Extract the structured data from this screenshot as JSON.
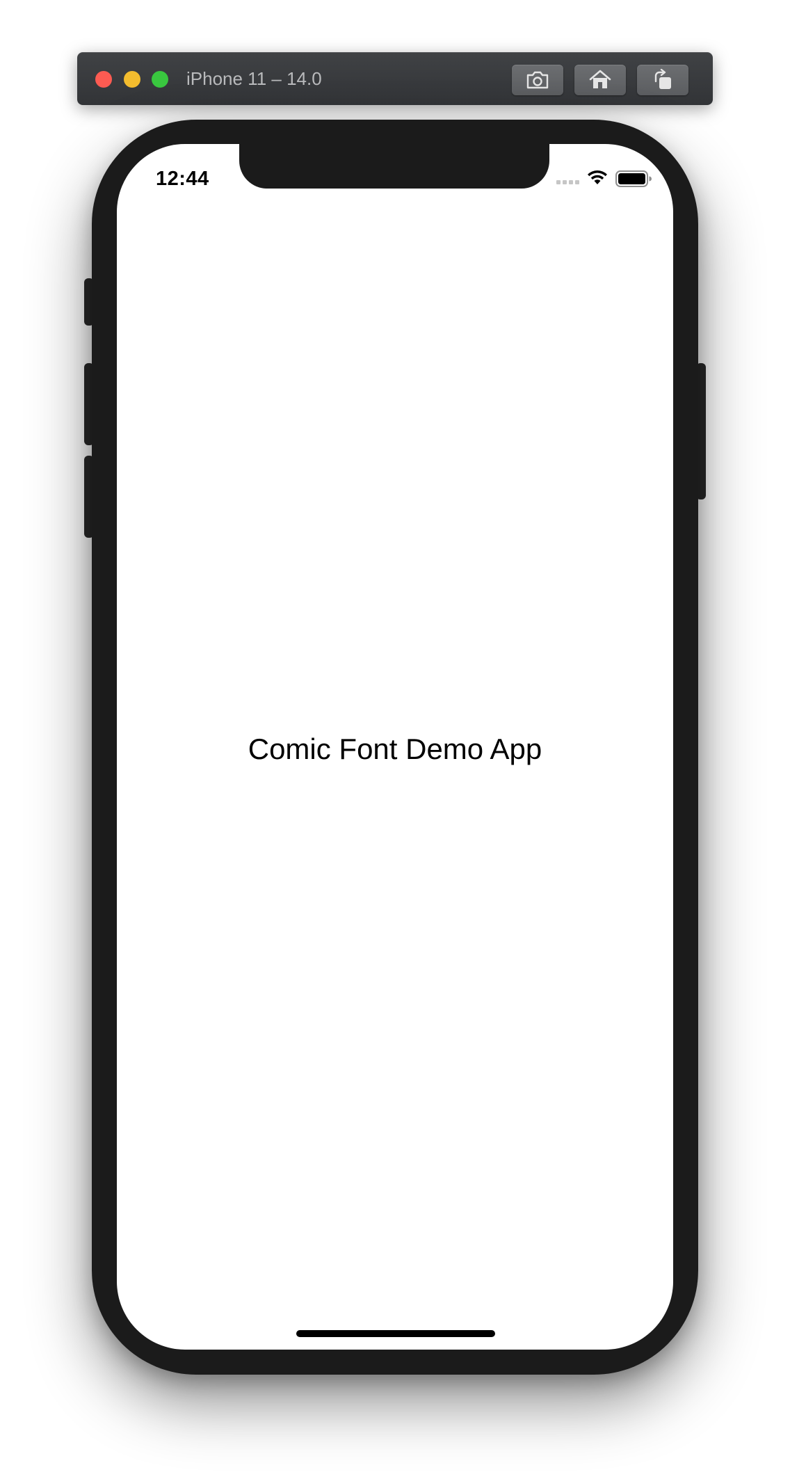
{
  "simulator": {
    "title": "iPhone 11 – 14.0",
    "traffic_lights": {
      "close_color": "#fd5b52",
      "minimize_color": "#f3bc2e",
      "zoom_color": "#39c73f"
    },
    "toolbar": {
      "screenshot_icon": "camera-icon",
      "home_icon": "home-icon",
      "rotate_icon": "rotate-icon"
    }
  },
  "status_bar": {
    "time": "12:44",
    "signal_icon": "cellular-signal-icon",
    "wifi_icon": "wifi-icon",
    "battery_icon": "battery-icon"
  },
  "app": {
    "title": "Comic Font Demo App"
  },
  "colors": {
    "device_frame": "#1b1b1b",
    "screen_background": "#ffffff",
    "titlebar": "#38393c",
    "toolbar_button": "#636568"
  }
}
